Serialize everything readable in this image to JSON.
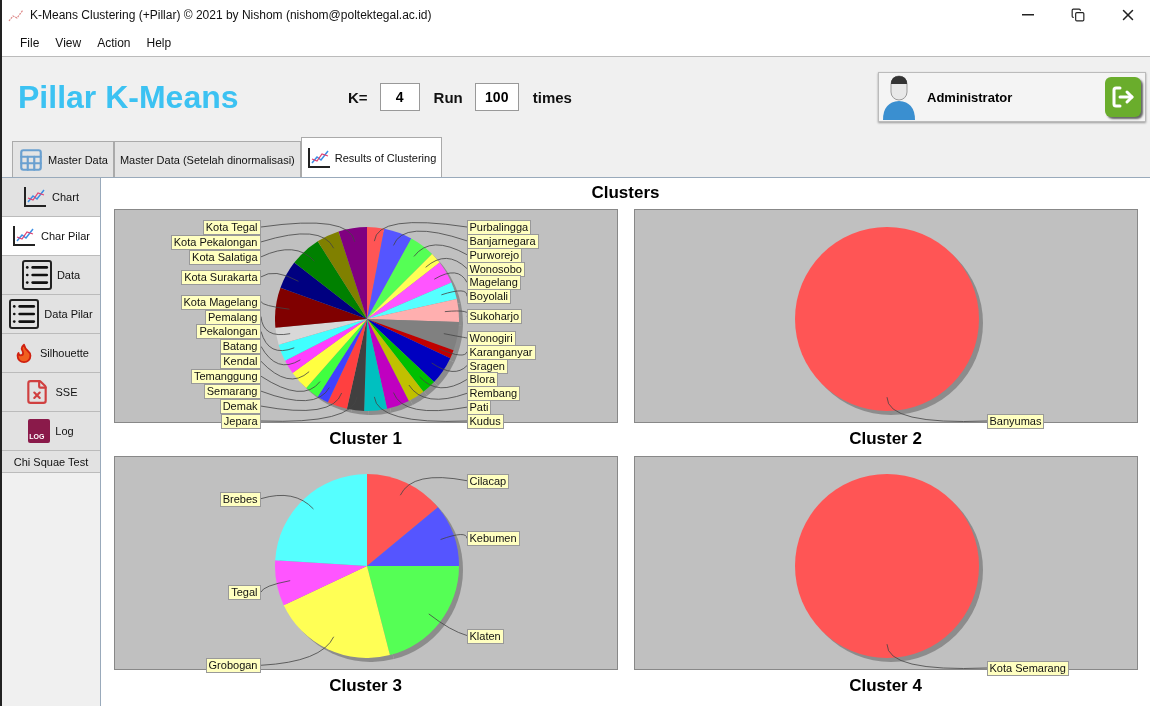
{
  "window": {
    "title": "K-Means Clustering (+Pillar) © 2021 by Nishom (nishom@poltektegal.ac.id)"
  },
  "menu": [
    {
      "label": "File"
    },
    {
      "label": "View"
    },
    {
      "label": "Action"
    },
    {
      "label": "Help"
    }
  ],
  "header": {
    "title": "Pillar K-Means",
    "k_label": "K=",
    "k_value": "4",
    "run_label": "Run",
    "run_value": "100",
    "times_label": "times",
    "user": "Administrator"
  },
  "tabs": [
    {
      "label": "Master Data",
      "kind": "table",
      "selected": false
    },
    {
      "label": "Master Data (Setelah dinormalisasi)",
      "kind": "plain",
      "selected": false
    },
    {
      "label": "Results of Clustering",
      "kind": "chart",
      "selected": true
    }
  ],
  "sidebar": [
    {
      "label": "Chart",
      "kind": "chart",
      "selected": false
    },
    {
      "label": "Char Pilar",
      "kind": "chart",
      "selected": true
    },
    {
      "label": "Data",
      "kind": "list",
      "selected": false
    },
    {
      "label": "Data Pilar",
      "kind": "list",
      "selected": false
    },
    {
      "label": "Silhouette",
      "kind": "flame",
      "selected": false
    },
    {
      "label": "SSE",
      "kind": "sheet",
      "selected": false
    },
    {
      "label": "Log",
      "kind": "log",
      "icon_text": "LOG",
      "selected": false
    },
    {
      "label": "Chi Squae Test",
      "kind": "plain",
      "selected": false
    }
  ],
  "content": {
    "title": "Clusters",
    "clusters": [
      {
        "chart_data": {
          "type": "pie",
          "title": "Cluster 1",
          "categories": [
            "Purbalingga",
            "Banjarnegara",
            "Purworejo",
            "Wonosobo",
            "Magelang",
            "Boyolali",
            "Sukoharjo",
            "Wonogiri",
            "Karanganyar",
            "Sragen",
            "Blora",
            "Rembang",
            "Pati",
            "Kudus",
            "Jepara",
            "Demak",
            "Semarang",
            "Temanggung",
            "Kendal",
            "Batang",
            "Pekalongan",
            "Pemalang",
            "Kota Magelang",
            "Kota Surakarta",
            "Kota Salatiga",
            "Kota Pekalongan",
            "Kota Tegal"
          ],
          "values": [
            3,
            5,
            4.5,
            2,
            4,
            3,
            4,
            5,
            1.5,
            5,
            2.5,
            3,
            4,
            4,
            3,
            3.5,
            2,
            2.5,
            3.5,
            2.5,
            3,
            3,
            7,
            5,
            5.5,
            4,
            5
          ]
        }
      },
      {
        "chart_data": {
          "type": "pie",
          "title": "Cluster 2",
          "categories": [
            "Banyumas"
          ],
          "values": [
            100
          ]
        }
      },
      {
        "chart_data": {
          "type": "pie",
          "title": "Cluster 3",
          "categories": [
            "Cilacap",
            "Kebumen",
            "Klaten",
            "Grobogan",
            "Tegal",
            "Brebes"
          ],
          "values": [
            14,
            11,
            21,
            22,
            8,
            24
          ]
        }
      },
      {
        "chart_data": {
          "type": "pie",
          "title": "Cluster 4",
          "categories": [
            "Kota Semarang"
          ],
          "values": [
            100
          ]
        }
      }
    ]
  }
}
